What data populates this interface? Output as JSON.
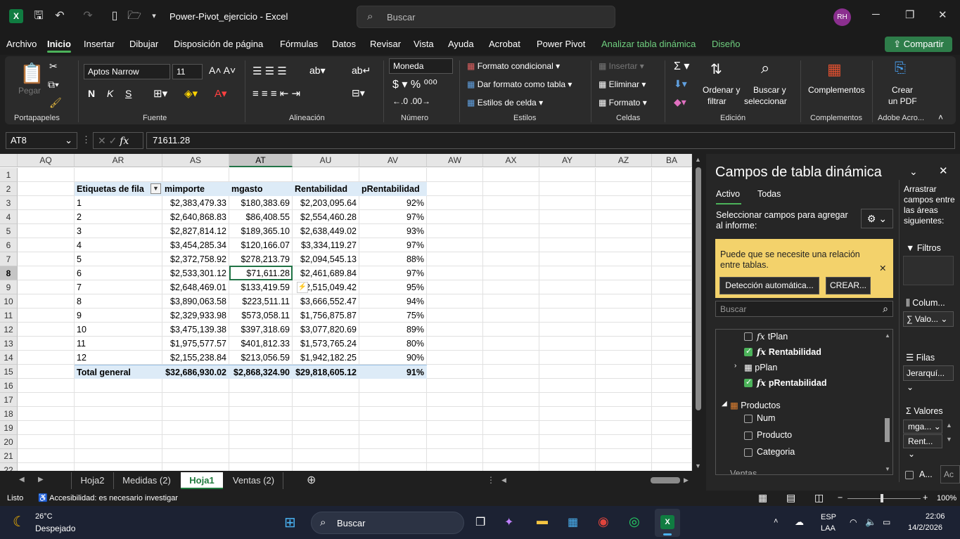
{
  "window": {
    "title": "Power-Pivot_ejercicio  -  Excel",
    "search_placeholder": "Buscar",
    "avatar": "RH"
  },
  "menu": [
    "Archivo",
    "Inicio",
    "Insertar",
    "Dibujar",
    "Disposición de página",
    "Fórmulas",
    "Datos",
    "Revisar",
    "Vista",
    "Ayuda",
    "Acrobat",
    "Power Pivot"
  ],
  "menu_ctx": [
    "Analizar tabla dinámica",
    "Diseño"
  ],
  "share": "Compartir",
  "ribbon": {
    "paste": "Pegar",
    "group_clipboard": "Portapapeles",
    "font_name": "Aptos Narrow",
    "font_size": "11",
    "group_font": "Fuente",
    "group_align": "Alineación",
    "number_format": "Moneda",
    "group_number": "Número",
    "cond_format": "Formato condicional",
    "table_format": "Dar formato como tabla",
    "cell_styles": "Estilos de celda",
    "group_styles": "Estilos",
    "insert": "Insertar",
    "delete": "Eliminar",
    "format": "Formato",
    "group_cells": "Celdas",
    "sort": "Ordenar y",
    "sort2": "filtrar",
    "find": "Buscar y",
    "find2": "seleccionar",
    "group_edit": "Edición",
    "addins": "Complementos",
    "group_addins": "Complementos",
    "pdf": "Crear",
    "pdf2": "un PDF",
    "group_adobe": "Adobe Acro..."
  },
  "formula_bar": {
    "name_box": "AT8",
    "formula": "71611.28"
  },
  "columns": [
    "AQ",
    "AR",
    "AS",
    "AT",
    "AU",
    "AV",
    "AW",
    "AX",
    "AY",
    "AZ",
    "BA"
  ],
  "rows": [
    "1",
    "2",
    "3",
    "4",
    "5",
    "6",
    "7",
    "8",
    "9",
    "10",
    "11",
    "12",
    "13",
    "14",
    "15",
    "16",
    "17",
    "18",
    "19",
    "20",
    "21",
    "22"
  ],
  "pivot": {
    "headers": [
      "Etiquetas de fila",
      "mimporte",
      "mgasto",
      "Rentabilidad",
      "pRentabilidad"
    ],
    "data": [
      [
        "1",
        "$2,383,479.33",
        "$180,383.69",
        "$2,203,095.64",
        "92%"
      ],
      [
        "2",
        "$2,640,868.83",
        "$86,408.55",
        "$2,554,460.28",
        "97%"
      ],
      [
        "3",
        "$2,827,814.12",
        "$189,365.10",
        "$2,638,449.02",
        "93%"
      ],
      [
        "4",
        "$3,454,285.34",
        "$120,166.07",
        "$3,334,119.27",
        "97%"
      ],
      [
        "5",
        "$2,372,758.92",
        "$278,213.79",
        "$2,094,545.13",
        "88%"
      ],
      [
        "6",
        "$2,533,301.12",
        "$71,611.28",
        "$2,461,689.84",
        "97%"
      ],
      [
        "7",
        "$2,648,469.01",
        "$133,419.59",
        "$2,515,049.42",
        "95%"
      ],
      [
        "8",
        "$3,890,063.58",
        "$223,511.11",
        "$3,666,552.47",
        "94%"
      ],
      [
        "9",
        "$2,329,933.98",
        "$573,058.11",
        "$1,756,875.87",
        "75%"
      ],
      [
        "10",
        "$3,475,139.38",
        "$397,318.69",
        "$3,077,820.69",
        "89%"
      ],
      [
        "11",
        "$1,975,577.57",
        "$401,812.33",
        "$1,573,765.24",
        "80%"
      ],
      [
        "12",
        "$2,155,238.84",
        "$213,056.59",
        "$1,942,182.25",
        "90%"
      ]
    ],
    "total": [
      "Total general",
      "$32,686,930.02",
      "$2,868,324.90",
      "$29,818,605.12",
      "91%"
    ]
  },
  "sheets": [
    "Hoja2",
    "Medidas (2)",
    "Hoja1",
    "Ventas (2)"
  ],
  "active_sheet": "Hoja1",
  "status": {
    "ready": "Listo",
    "accessibility": "Accesibilidad: es necesario investigar",
    "zoom": "100%"
  },
  "pane": {
    "title": "Campos de tabla dinámica",
    "tab_active": "Activo",
    "tab_all": "Todas",
    "instruction": "Seleccionar campos para agregar al informe:",
    "notice": "Puede que se necesite una relación entre tablas.",
    "detect_btn": "Detección automática...",
    "create_btn": "CREAR...",
    "search_placeholder": "Buscar",
    "fields": [
      {
        "label": "tPlan",
        "type": "fx",
        "checked": false
      },
      {
        "label": "Rentabilidad",
        "type": "fx",
        "checked": true
      },
      {
        "label": "pPlan",
        "type": "kpi",
        "checked": false
      },
      {
        "label": "pRentabilidad",
        "type": "fx",
        "checked": true
      }
    ],
    "table_name": "Productos",
    "table_fields": [
      "Num",
      "Producto",
      "Categoria"
    ],
    "next_table": "Ventas",
    "drag_text": "Arrastrar campos entre las áreas siguientes:",
    "areas": {
      "filters": "Filtros",
      "columns": "Colum...",
      "columns_item": "Valo...",
      "rows": "Filas",
      "rows_item": "Jerarquí...",
      "values": "Valores",
      "values_items": [
        "mga...",
        "Rent..."
      ]
    },
    "defer": "A...",
    "update": "Ac"
  },
  "taskbar": {
    "temp": "26°C",
    "weather": "Despejado",
    "search": "Buscar",
    "lang1": "ESP",
    "lang2": "LAA",
    "time": "22:06",
    "date": "14/2/2026"
  }
}
